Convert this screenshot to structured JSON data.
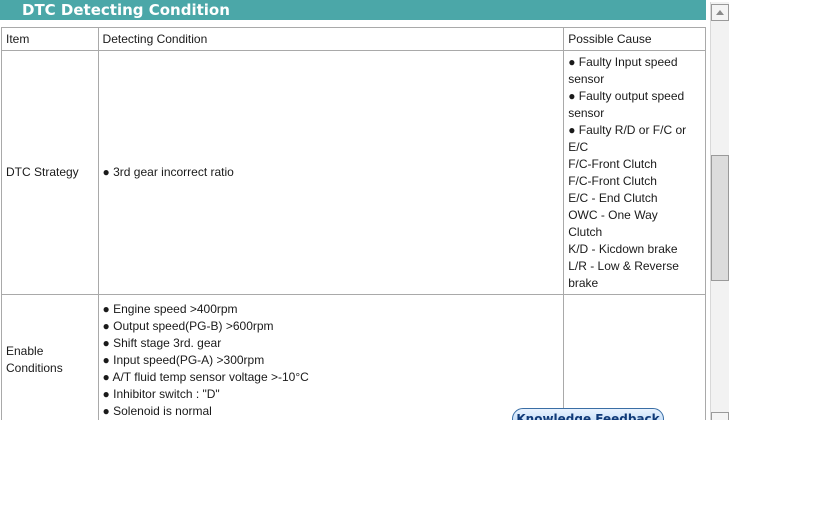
{
  "title": "DTC Detecting Condition",
  "table": {
    "headers": [
      "Item",
      "Detecting Condition",
      "Possible Cause"
    ],
    "rows": [
      {
        "item": "DTC Strategy",
        "conditions": [
          "● 3rd gear incorrect ratio"
        ],
        "causes": [
          "● Faulty Input speed",
          "sensor",
          "● Faulty output speed",
          "sensor",
          "● Faulty R/D or F/C or",
          "E/C",
          "F/C-Front Clutch",
          "F/C-Front Clutch",
          "E/C - End Clutch",
          "OWC - One Way",
          "Clutch",
          "K/D - Kicdown brake",
          "L/R - Low & Reverse",
          "brake"
        ]
      },
      {
        "item_lines": [
          "Enable",
          "Conditions"
        ],
        "conditions": [
          "● Engine speed >400rpm",
          "● Output speed(PG-B) >600rpm",
          "● Shift stage 3rd. gear",
          "● Input speed(PG-A) >300rpm",
          "● A/T fluid temp sensor voltage >-10°C",
          "● Inhibitor switch : \"D\"",
          "● Solenoid is normal"
        ],
        "causes": []
      }
    ]
  },
  "feedback_button": "Knowledge Feedback",
  "colors": {
    "title_bar": "#4ba7a8",
    "title_text": "#ffffff",
    "table_border": "#a9a9a9"
  }
}
